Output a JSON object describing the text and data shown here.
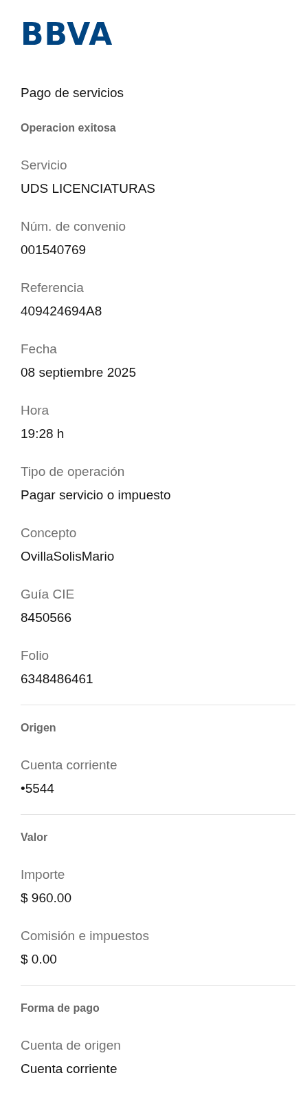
{
  "header": {
    "logo": "BBVA"
  },
  "title": "Pago de servicios",
  "sections": [
    {
      "heading": "Operacion exitosa",
      "fields": [
        {
          "label": "Servicio",
          "value": "UDS LICENCIATURAS"
        },
        {
          "label": "Núm. de convenio",
          "value": "001540769"
        },
        {
          "label": "Referencia",
          "value": "409424694A8"
        },
        {
          "label": "Fecha",
          "value": "08 septiembre 2025"
        },
        {
          "label": "Hora",
          "value": "19:28 h"
        },
        {
          "label": "Tipo de operación",
          "value": "Pagar servicio o impuesto"
        },
        {
          "label": "Concepto",
          "value": "OvillaSolisMario"
        },
        {
          "label": "Guía CIE",
          "value": "8450566"
        },
        {
          "label": "Folio",
          "value": "6348486461"
        }
      ]
    },
    {
      "heading": "Origen",
      "fields": [
        {
          "label": "Cuenta corriente",
          "value": "•5544"
        }
      ]
    },
    {
      "heading": "Valor",
      "fields": [
        {
          "label": "Importe",
          "value": "$ 960.00"
        },
        {
          "label": "Comisión e impuestos",
          "value": "$ 0.00"
        }
      ]
    },
    {
      "heading": "Forma de pago",
      "fields": [
        {
          "label": "Cuenta de origen",
          "value": "Cuenta corriente"
        }
      ]
    }
  ]
}
